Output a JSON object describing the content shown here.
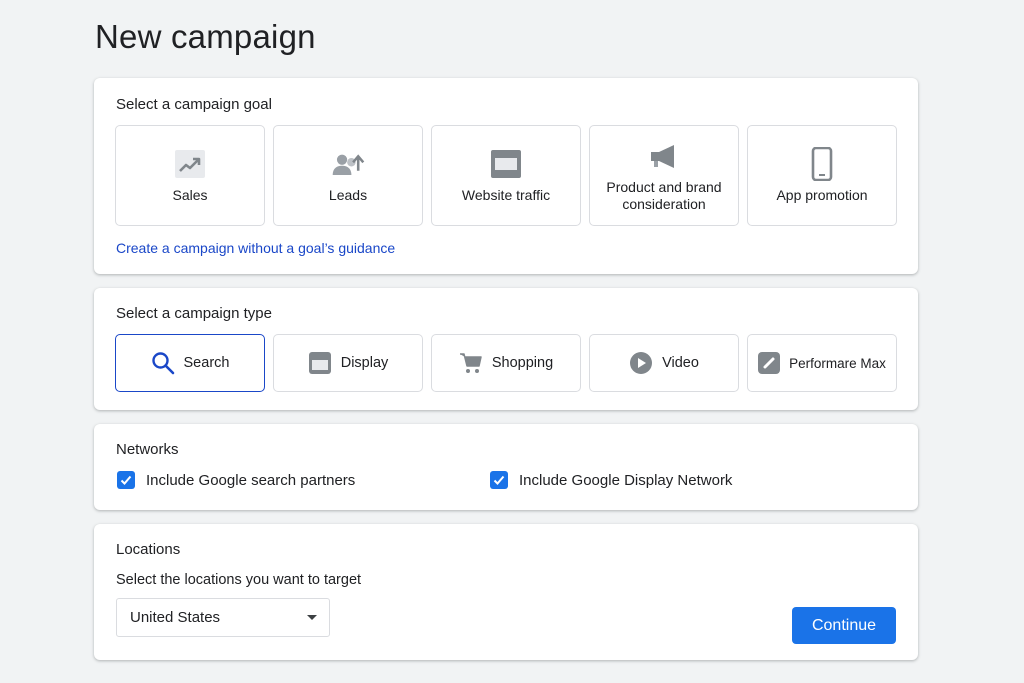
{
  "page_title": "New campaign",
  "goal_section": {
    "heading": "Select a campaign goal",
    "goals": [
      {
        "label": "Sales",
        "icon": "trending-up-icon"
      },
      {
        "label": "Leads",
        "icon": "add-person-icon"
      },
      {
        "label": "Website traffic",
        "icon": "browser-window-icon"
      },
      {
        "label": "Product and brand consideration",
        "icon": "megaphone-icon"
      },
      {
        "label": "App promotion",
        "icon": "phone-icon"
      }
    ],
    "no_goal_link": "Create a campaign without a goal’s guidance"
  },
  "type_section": {
    "heading": "Select a campaign type",
    "types": [
      {
        "label": "Search",
        "icon": "search-icon",
        "selected": true
      },
      {
        "label": "Display",
        "icon": "display-icon",
        "selected": false
      },
      {
        "label": "Shopping",
        "icon": "cart-icon",
        "selected": false
      },
      {
        "label": "Video",
        "icon": "play-icon",
        "selected": false
      },
      {
        "label": "Performare Max",
        "icon": "link-icon",
        "selected": false
      }
    ]
  },
  "networks": {
    "heading": "Networks",
    "options": [
      {
        "label": "Include Google search partners",
        "checked": true
      },
      {
        "label": "Include Google Display Network",
        "checked": true
      }
    ]
  },
  "locations": {
    "heading": "Locations",
    "subheading": "Select the locations you want to target",
    "selected_location": "United States",
    "continue_label": "Continue"
  },
  "colors": {
    "accent": "#1a73e8",
    "link": "#1a47c8",
    "selected_border": "#1a47c8",
    "icon_gray": "#80868b"
  }
}
